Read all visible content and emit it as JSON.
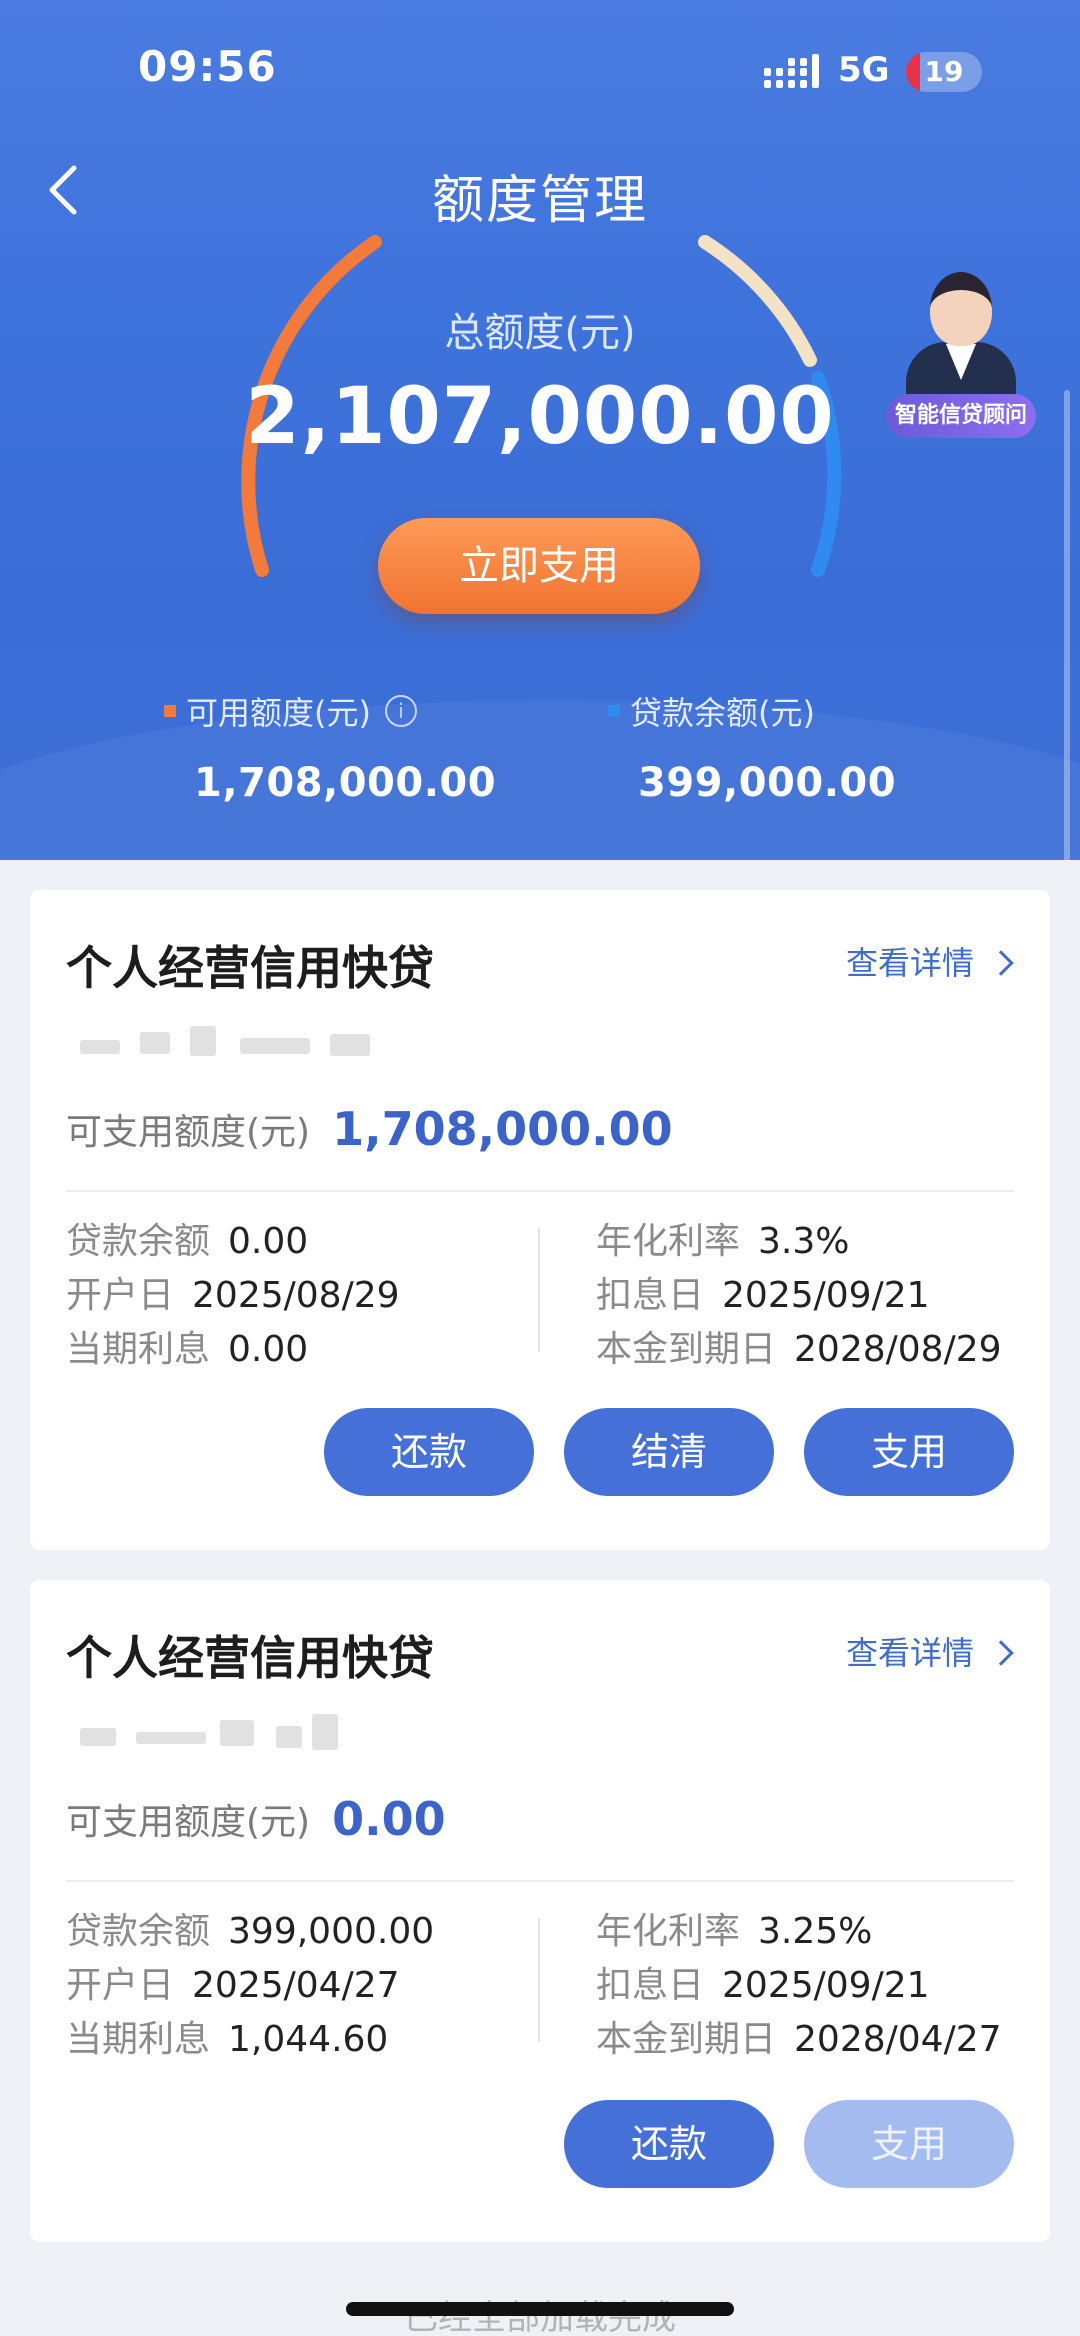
{
  "status_bar": {
    "time": "09:56",
    "network": "5G",
    "battery_level": "19",
    "battery_fraction": 0.19,
    "icons": [
      "signal-icon",
      "battery-icon"
    ]
  },
  "nav": {
    "title": "额度管理",
    "back_icon": "chevron-left-icon"
  },
  "hero": {
    "total_label": "总额度(元)",
    "total_amount": "2,107,000.00",
    "use_now_label": "立即支用",
    "advisor_label": "智能信贷顾问",
    "available_label": "可用额度(元)",
    "available_value": "1,708,000.00",
    "loan_label": "贷款余额(元)",
    "loan_value": "399,000.00",
    "available_color": "#f27a3a",
    "loan_color": "#2f8bf0"
  },
  "cards": [
    {
      "title": "个人经营信用快贷",
      "detail_label": "查看详情",
      "avail_label": "可支用额度(元)",
      "avail_value": "1,708,000.00",
      "left": [
        {
          "k": "贷款余额",
          "v": "0.00"
        },
        {
          "k": "开户日",
          "v": "2025/08/29"
        },
        {
          "k": "当期利息",
          "v": "0.00"
        }
      ],
      "right": [
        {
          "k": "年化利率",
          "v": "3.3%"
        },
        {
          "k": "扣息日",
          "v": "2025/09/21"
        },
        {
          "k": "本金到期日",
          "v": "2028/08/29"
        }
      ],
      "buttons": [
        "还款",
        "结清",
        "支用"
      ]
    },
    {
      "title": "个人经营信用快贷",
      "detail_label": "查看详情",
      "avail_label": "可支用额度(元)",
      "avail_value": "0.00",
      "left": [
        {
          "k": "贷款余额",
          "v": "399,000.00"
        },
        {
          "k": "开户日",
          "v": "2025/04/27"
        },
        {
          "k": "当期利息",
          "v": "1,044.60"
        }
      ],
      "right": [
        {
          "k": "年化利率",
          "v": "3.25%"
        },
        {
          "k": "扣息日",
          "v": "2025/09/21"
        },
        {
          "k": "本金到期日",
          "v": "2028/04/27"
        }
      ],
      "buttons": [
        "还款",
        "支用"
      ]
    }
  ],
  "footer": {
    "loaded_text": "已经全部加载完成"
  }
}
